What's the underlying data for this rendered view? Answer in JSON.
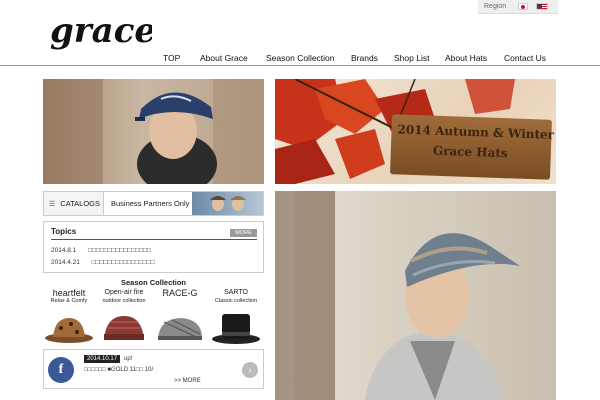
{
  "brand": {
    "logo_text": "grace"
  },
  "region": {
    "label": "Region",
    "flags": [
      "japan-flag",
      "usa-flag"
    ]
  },
  "nav": {
    "items": [
      "TOP",
      "About Grace",
      "Season Collection",
      "Brands",
      "Shop List",
      "About Hats",
      "Contact Us"
    ]
  },
  "autumn_banner": {
    "line1": "2014 Autumn & Winter",
    "line2": "Grace Hats"
  },
  "catalog": {
    "catalogs_label": "CATALOGS",
    "partners_label": "Business Partners Only"
  },
  "topics": {
    "title": "Topics",
    "more_label": "MORE",
    "items": [
      {
        "date": "2014.8.1",
        "title": "□□□□□□□□□□□□□□□□"
      },
      {
        "date": "2014.4.21",
        "title": "□□□□□□□□□□□□□□□□"
      }
    ]
  },
  "season": {
    "title": "Season Collection",
    "brands": [
      {
        "name": "heartfelt",
        "sub": "Relax & Comfy"
      },
      {
        "name": "Open-air fire",
        "sub": "outdoor collection"
      },
      {
        "name": "RACE-G",
        "sub": ""
      },
      {
        "name": "SARTO",
        "sub": "Classic collection"
      }
    ]
  },
  "facebook": {
    "date": "2014.10.17",
    "up_label": "up!",
    "text": "□□□□□□ ■GOLD 11□□ 10/",
    "more_label": ">> MORE",
    "next_label": "›"
  },
  "colors": {
    "facebook_blue": "#3b5998",
    "leaf_red": "#c8321a",
    "nav_rule": "#999999"
  }
}
